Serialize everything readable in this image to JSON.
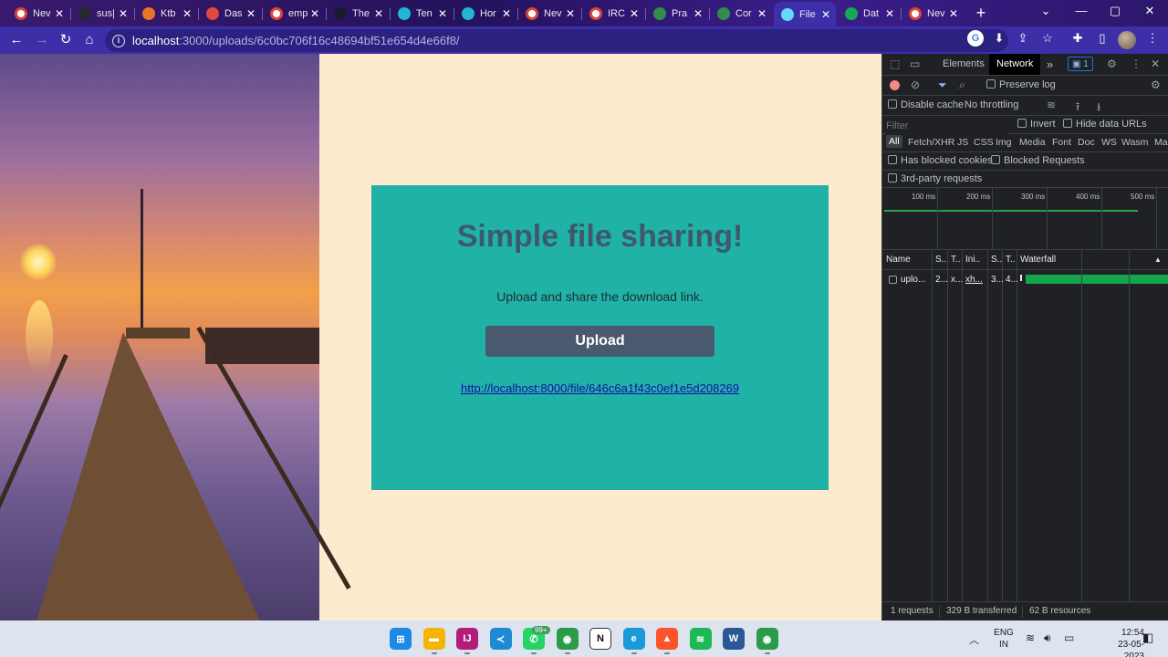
{
  "browser": {
    "tabs": [
      {
        "label": "Nev",
        "icon": "chrome-icon",
        "color": "#ffffff"
      },
      {
        "label": "sus|",
        "icon": "github-icon",
        "color": "#24292e"
      },
      {
        "label": "Ktb",
        "icon": "coding-icon",
        "color": "#e8742a"
      },
      {
        "label": "Das",
        "icon": "firebase-icon",
        "color": "#e2483d"
      },
      {
        "label": "emp",
        "icon": "google-icon",
        "color": "#ffffff"
      },
      {
        "label": "The",
        "icon": "hacker-icon",
        "color": "#1a1a2e"
      },
      {
        "label": "Ten",
        "icon": "c-icon",
        "color": "#23b5d3"
      },
      {
        "label": "Hor",
        "icon": "c-icon",
        "color": "#23b5d3"
      },
      {
        "label": "Nev",
        "icon": "chrome-icon",
        "color": "#ffffff"
      },
      {
        "label": "IRC",
        "icon": "irc-icon",
        "color": "#ffffff"
      },
      {
        "label": "Pra",
        "icon": "gfg-icon",
        "color": "#2f8d46"
      },
      {
        "label": "Cor",
        "icon": "gfg-icon",
        "color": "#2f8d46"
      },
      {
        "label": "File",
        "icon": "react-icon",
        "color": "#61dafb"
      },
      {
        "label": "Dat",
        "icon": "mongodb-icon",
        "color": "#13aa52"
      },
      {
        "label": "Nev",
        "icon": "chrome-icon",
        "color": "#ffffff"
      }
    ],
    "active_tab_index": 12,
    "close_glyph": "✕",
    "new_tab_glyph": "+",
    "url_host": "localhost",
    "url_path": ":3000/uploads/6c0bc706f16c48694bf51e654d4e66f8/",
    "window_controls": {
      "dropdown": "⌄",
      "minimize": "—",
      "maximize": "▢",
      "close": "✕"
    }
  },
  "page": {
    "title": "Simple file sharing!",
    "subtitle": "Upload and share the download link.",
    "upload_button": "Upload",
    "download_link": "http://localhost:8000/file/646c6a1f43c0ef1e5d208269",
    "colors": {
      "background": "#fdebd0",
      "card": "#20b2a6",
      "title": "#3d5a6c",
      "button": "#4a5a6e",
      "link": "#1a0dab"
    }
  },
  "devtools": {
    "tabs": {
      "elements": "Elements",
      "network": "Network",
      "more": "»",
      "issues_count": "1"
    },
    "toolbar": {
      "preserve_log": "Preserve log",
      "disable_cache": "Disable cache",
      "throttling": "No throttling"
    },
    "filter": {
      "placeholder": "Filter",
      "invert": "Invert",
      "hide_data_urls": "Hide data URLs"
    },
    "types": [
      "All",
      "Fetch/XHR",
      "JS",
      "CSS",
      "Img",
      "Media",
      "Font",
      "Doc",
      "WS",
      "Wasm",
      "Ma"
    ],
    "options": {
      "blocked_cookies": "Has blocked cookies",
      "blocked_requests": "Blocked Requests",
      "third_party": "3rd-party requests"
    },
    "timeline_ticks": [
      "100 ms",
      "200 ms",
      "300 ms",
      "400 ms",
      "500 ms"
    ],
    "columns": [
      "Name",
      "S..",
      "T..",
      "Ini..",
      "S..",
      "T..",
      "Waterfall"
    ],
    "rows": [
      {
        "name": "uplo...",
        "status": "2...",
        "type": "x...",
        "initiator": "xh...",
        "size": "3...",
        "time": "4..."
      }
    ],
    "status": {
      "requests": "1 requests",
      "transferred": "329 B transferred",
      "resources": "62 B resources"
    }
  },
  "taskbar": {
    "apps": [
      {
        "name": "windows-start-icon",
        "color": "#1e88e5",
        "glyph": "⊞"
      },
      {
        "name": "file-explorer-icon",
        "color": "#f4b400",
        "glyph": "▬"
      },
      {
        "name": "intellij-icon",
        "color": "#b01e7a",
        "glyph": "IJ"
      },
      {
        "name": "vscode-icon",
        "color": "#1f8ad2",
        "glyph": "≺"
      },
      {
        "name": "whatsapp-icon",
        "color": "#25d366",
        "glyph": "✆"
      },
      {
        "name": "chrome-icon",
        "color": "#2b9b4a",
        "glyph": "◉"
      },
      {
        "name": "notion-icon",
        "color": "#ffffff",
        "glyph": "N"
      },
      {
        "name": "edge-icon",
        "color": "#1a9bd7",
        "glyph": "e"
      },
      {
        "name": "brave-icon",
        "color": "#fb542b",
        "glyph": "▲"
      },
      {
        "name": "spotify-icon",
        "color": "#1db954",
        "glyph": "≋"
      },
      {
        "name": "word-icon",
        "color": "#2b5797",
        "glyph": "W"
      },
      {
        "name": "chrome-profile-icon",
        "color": "#2b9b4a",
        "glyph": "◉"
      }
    ],
    "whatsapp_badge": "99+",
    "lang": "ENG",
    "region": "IN",
    "time": "12:54",
    "date": "23-05-2023"
  }
}
